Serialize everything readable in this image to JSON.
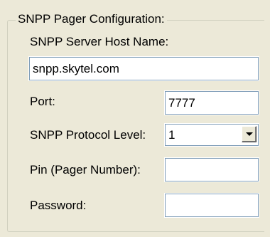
{
  "group": {
    "title": "SNPP Pager Configuration:"
  },
  "server": {
    "label": "SNPP Server Host Name:",
    "value": "snpp.skytel.com"
  },
  "port": {
    "label": "Port:",
    "value": "7777"
  },
  "protocol": {
    "label": "SNPP Protocol Level:",
    "value": "1",
    "icon": "chevron-down-icon"
  },
  "pin": {
    "label": "Pin (Pager Number):",
    "value": ""
  },
  "password": {
    "label": "Password:",
    "value": ""
  }
}
